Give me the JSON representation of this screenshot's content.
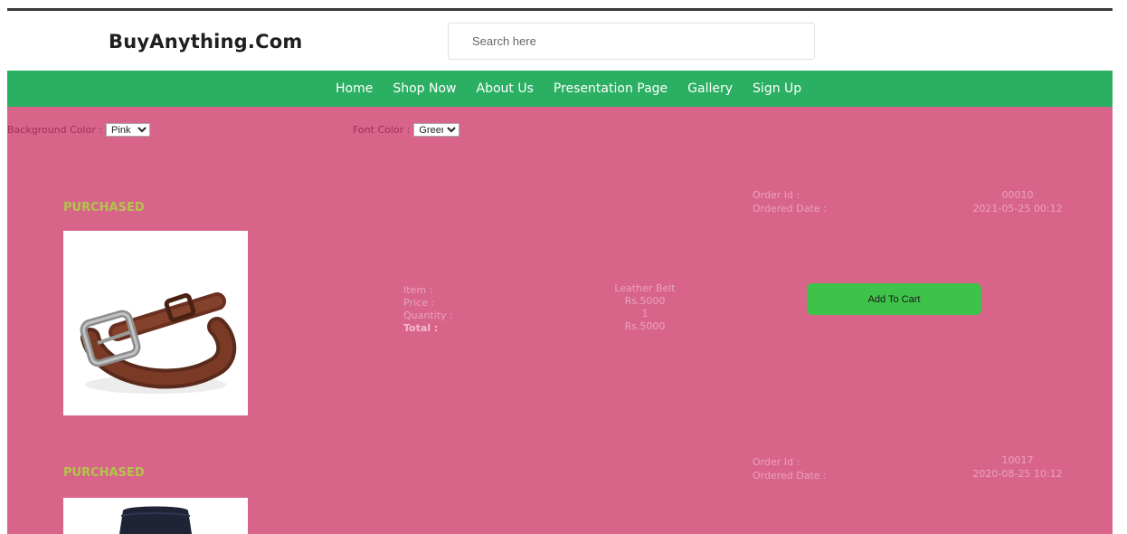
{
  "brand": "BuyAnything.Com",
  "search": {
    "placeholder": "Search here"
  },
  "nav": {
    "items": [
      "Home",
      "Shop Now",
      "About Us",
      "Presentation Page",
      "Gallery",
      "Sign Up"
    ]
  },
  "controls": {
    "background_color": {
      "label": "Background Color :",
      "value": "Pink"
    },
    "font_color": {
      "label": "Font Color :",
      "value": "Green"
    }
  },
  "labels": {
    "order_id": "Order Id :",
    "ordered_date": "Ordered Date :",
    "item": "Item :",
    "price": "Price :",
    "quantity": "Quantity :",
    "total": "Total :",
    "add_to_cart": "Add To Cart"
  },
  "orders": [
    {
      "status": "PURCHASED",
      "order_id": "00010",
      "ordered_date": "2021-05-25 00:12",
      "item": "Leather Belt",
      "price": "Rs.5000",
      "quantity": "1",
      "total": "Rs.5000",
      "image_icon": "leather-belt"
    },
    {
      "status": "PURCHASED",
      "order_id": "10017",
      "ordered_date": "2020-08-25 10:12",
      "image_icon": "trousers"
    }
  ],
  "colors": {
    "nav_bg": "#2aaf63",
    "page_bg": "#d8648a",
    "status_text": "#b2c54a",
    "button_bg": "#3ec24a"
  }
}
